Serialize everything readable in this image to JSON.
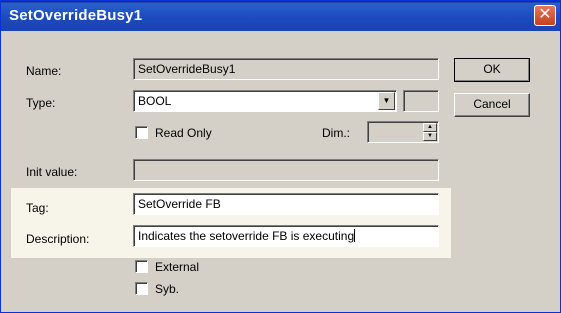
{
  "window": {
    "title": "SetOverrideBusy1",
    "close_symbol": "✕",
    "title_bar_color": "#1c4bbd",
    "background_color": "#d4d0c8"
  },
  "fields": {
    "name": {
      "label": "Name:",
      "value": "SetOverrideBusy1"
    },
    "type": {
      "label": "Type:",
      "value": "BOOL",
      "dropdown_icon": "chevron-down-icon"
    },
    "read_only": {
      "label": "Read Only",
      "checked": false
    },
    "dim": {
      "label": "Dim.:",
      "value": ""
    },
    "init_value": {
      "label": "Init value:",
      "value": ""
    },
    "tag": {
      "label": "Tag:",
      "value": "SetOverride FB"
    },
    "description": {
      "label": "Description:",
      "value": "Indicates the setoverride FB is executing"
    },
    "external": {
      "label": "External",
      "checked": false
    },
    "syb": {
      "label": "Syb.",
      "checked": false
    }
  },
  "buttons": {
    "ok": "OK",
    "cancel": "Cancel"
  },
  "highlight_color": "#f7f4ea"
}
